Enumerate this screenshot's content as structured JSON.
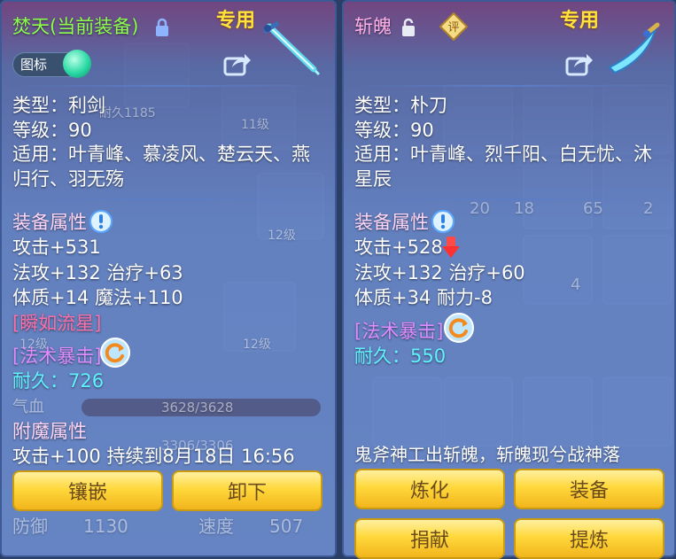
{
  "left": {
    "title": "焚天(当前装备)",
    "badge": "专用",
    "toggle_label": "图标",
    "type": "类型：利剑",
    "level": "等级：90",
    "usable": "适用：叶青峰、慕凌风、楚云天、燕归行、羽无殇",
    "attr_title": "装备属性",
    "stat1": "攻击+531",
    "stat2": "法攻+132 治疗+63",
    "stat3": "体质+14 魔法+110",
    "skill1": "[瞬如流星]",
    "skill2": "[法术暴击]",
    "durability": "耐久：726",
    "enchant_title": "附魔属性",
    "enchant": "攻击+100 持续到8月18日 16:56",
    "btn_inlay": "镶嵌",
    "btn_unequip": "卸下"
  },
  "right": {
    "title": "斩魄",
    "badge": "专用",
    "seal": "评",
    "type": "类型：朴刀",
    "level": "等级：90",
    "usable": "适用：叶青峰、烈千阳、白无忧、沐星辰",
    "attr_title": "装备属性",
    "stat1": "攻击+528",
    "stat2": "法攻+132 治疗+60",
    "stat3": "体质+34 耐力-8",
    "skill1": "[法术暴击]",
    "durability": "耐久：550",
    "desc": "鬼斧神工出斩魄，斩魄现兮战神落",
    "btn_refine": "炼化",
    "btn_equip": "装备",
    "btn_donate": "捐献",
    "btn_extract": "提炼"
  },
  "background": {
    "durability_hint": "耐久1185",
    "lv1": "11级",
    "lv2": "12级",
    "lv3": "12级",
    "lv4": "12级",
    "qi": "气血",
    "qi_value": "3628/3628",
    "mp_value": "3306/3306",
    "def": "防御",
    "def_value": "1130",
    "spd": "速度",
    "spd_value": "507",
    "n1": "20",
    "n2": "18",
    "n3": "65",
    "n4": "2",
    "n5": "4"
  },
  "colors": {
    "title_green": "#8cff4a",
    "section_pink": "#ffd6f7",
    "skill_purple": "#e08cff",
    "durability_cyan": "#60f2ff",
    "badge_gold": "#ffe23a",
    "button_gold": "#ffd83c"
  },
  "icons": [
    "lock-icon",
    "unlock-icon",
    "share-icon",
    "info-icon",
    "refresh-icon",
    "down-arrow-icon",
    "sword-icon",
    "blade-icon",
    "rating-seal-icon"
  ]
}
